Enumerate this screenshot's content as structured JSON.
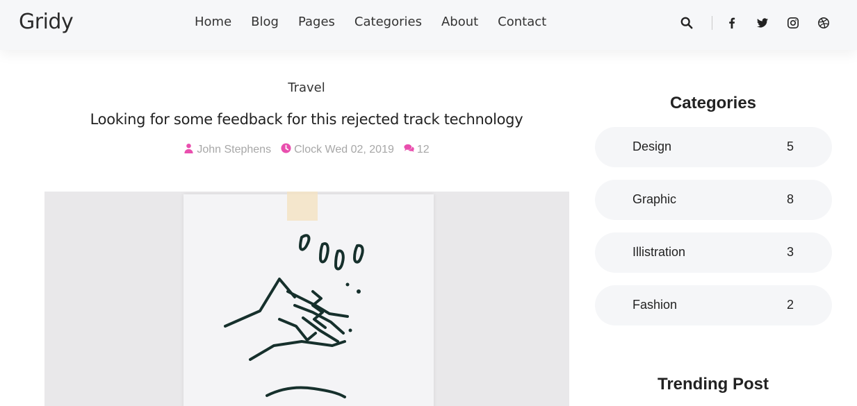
{
  "header": {
    "logo": "Gridy",
    "nav": [
      "Home",
      "Blog",
      "Pages",
      "Categories",
      "About",
      "Contact"
    ],
    "icons": [
      "search-icon",
      "facebook-icon",
      "twitter-icon",
      "instagram-icon",
      "dribbble-icon"
    ]
  },
  "post": {
    "category": "Travel",
    "title": "Looking for some feedback for this rejected track technology",
    "author": "John Stephens",
    "date": "Clock Wed 02, 2019",
    "comments": "12",
    "meta_color": "#e94fae"
  },
  "sidebar": {
    "categories_title": "Categories",
    "categories": [
      {
        "name": "Design",
        "count": "5"
      },
      {
        "name": "Graphic",
        "count": "8"
      },
      {
        "name": "Illistration",
        "count": "3"
      },
      {
        "name": "Fashion",
        "count": "2"
      }
    ],
    "trending_title": "Trending Post"
  }
}
